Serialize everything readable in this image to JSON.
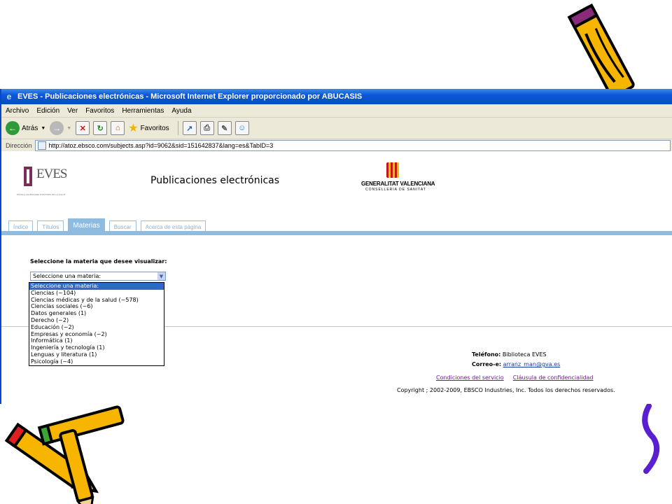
{
  "window": {
    "title": "EVES - Publicaciones electrónicas - Microsoft Internet Explorer proporcionado por ABUCASIS"
  },
  "menu": [
    "Archivo",
    "Edición",
    "Ver",
    "Favoritos",
    "Herramientas",
    "Ayuda"
  ],
  "toolbar": {
    "back_label": "Atrás",
    "favorites_label": "Favoritos",
    "icons": [
      "back-icon",
      "forward-icon",
      "stop-icon",
      "refresh-icon",
      "home-icon",
      "favorites-icon",
      "history-icon",
      "print-icon",
      "edit-icon",
      "messenger-icon"
    ]
  },
  "address": {
    "label": "Dirección",
    "url": "http://atoz.ebsco.com/subjects.asp?id=9062&sid=151642837&lang=es&TabID=3"
  },
  "page": {
    "logo_text": "EVES",
    "logo_subtext": "ESCOLA VALENCIANA D'ESTUDIS DE LA SALUT",
    "heading": "Publicaciones electrónicas",
    "gva_name": "GENERALITAT VALENCIANA",
    "gva_sub": "CONSELLERIA DE SANITAT"
  },
  "tabs": [
    {
      "label": "Índice",
      "active": false
    },
    {
      "label": "Títulos",
      "active": false
    },
    {
      "label": "Materias",
      "active": true
    },
    {
      "label": "Buscar",
      "active": false
    },
    {
      "label": "Acerca de esta página",
      "active": false
    }
  ],
  "subject_select": {
    "prompt": "Seleccione la materia que desee visualizar:",
    "selected": "Seleccione una materia:",
    "options": [
      "Seleccione una materia:",
      "Ciencias (~104)",
      "Ciencias médicas y de la salud (~578)",
      "Ciencias sociales (~6)",
      "Datos generales (1)",
      "Derecho (~2)",
      "Educación (~2)",
      "Empresas y economía (~2)",
      "Informática (1)",
      "Ingeniería y tecnología (1)",
      "Lenguas y literatura (1)",
      "Psicología (~4)"
    ]
  },
  "footer": {
    "phone_label": "Teléfono:",
    "phone_value": "Biblioteca EVES",
    "email_label": "Correo-e:",
    "email_value": "arranz_man@gva.es",
    "terms_link": "Condiciones del servicio",
    "privacy_link": "Cláusula de confidencialidad",
    "copyright": "Copyright ; 2002-2009, EBSCO Industries, Inc. Todos los derechos reservados."
  },
  "colors": {
    "titlebar": "#0a57d7",
    "tab_accent": "#8dbce0",
    "link_visited": "#6a1b9a",
    "pencil_yellow": "#f7b500"
  }
}
